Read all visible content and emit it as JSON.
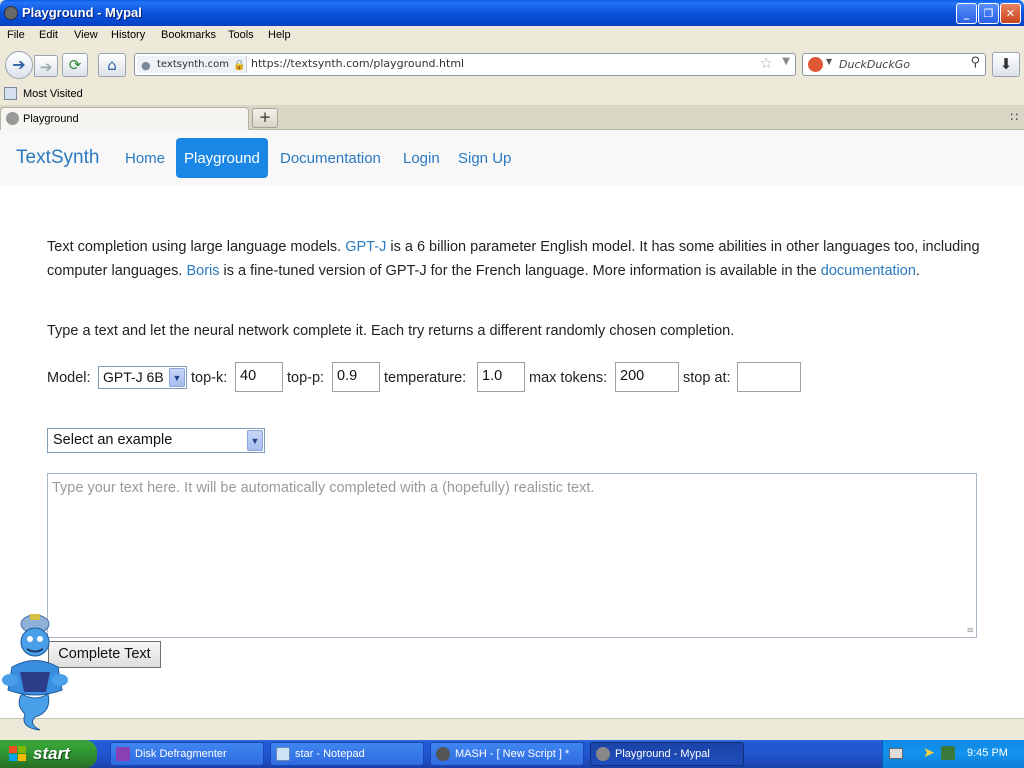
{
  "window": {
    "title": "Playground - Mypal"
  },
  "menu": [
    "File",
    "Edit",
    "View",
    "History",
    "Bookmarks",
    "Tools",
    "Help"
  ],
  "urlbar": {
    "site": "textsynth.com",
    "url": "https://textsynth.com/playground.html"
  },
  "search": {
    "placeholder": "DuckDuckGo"
  },
  "bookmarks": {
    "item": "Most Visited"
  },
  "tabs": [
    {
      "title": "Playground"
    }
  ],
  "site": {
    "brand": "TextSynth",
    "nav": [
      "Home",
      "Playground",
      "Documentation",
      "Login",
      "Sign Up"
    ],
    "active_nav": "Playground"
  },
  "content": {
    "intro_1": "Text completion using large language models. ",
    "link_gptj": "GPT-J",
    "intro_2": " is a 6 billion parameter English model. It has some abilities in other languages too, including computer languages. ",
    "link_boris": "Boris",
    "intro_3": " is a fine-tuned version of GPT-J for the French language. More information is available in the ",
    "link_docs": "documentation",
    "intro_4": ".",
    "instruction": "Type a text and let the neural network complete it. Each try returns a different randomly chosen completion."
  },
  "params": {
    "model_label": "Model:",
    "model_value": "GPT-J 6B",
    "topk_label": "top-k:",
    "topk_value": "40",
    "topp_label": "top-p:",
    "topp_value": "0.9",
    "temperature_label": "temperature:",
    "temperature_value": "1.0",
    "maxtokens_label": "max tokens:",
    "maxtokens_value": "200",
    "stopat_label": "stop at:",
    "stopat_value": ""
  },
  "example_select": {
    "value": "Select an example"
  },
  "textarea": {
    "placeholder": "Type your text here. It will be automatically completed with a (hopefully) realistic text."
  },
  "complete_button": "Complete Text",
  "taskbar": {
    "start": "start",
    "tasks": [
      "Disk Defragmenter",
      "star - Notepad",
      "MASH - [ New Script ] *",
      "Playground - Mypal"
    ],
    "active_task": "Playground - Mypal",
    "clock": "9:45 PM"
  },
  "colors": {
    "link": "#2a7ac2",
    "active_nav_bg": "#1a86e6",
    "taskbar": "#245edb",
    "start": "#37a537"
  }
}
